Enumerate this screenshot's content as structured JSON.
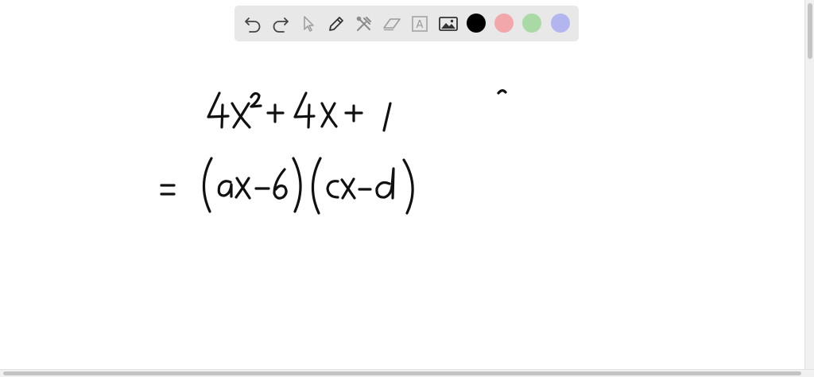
{
  "toolbar": {
    "tools": [
      {
        "name": "undo-icon"
      },
      {
        "name": "redo-icon"
      },
      {
        "name": "pointer-icon"
      },
      {
        "name": "pencil-icon"
      },
      {
        "name": "tools-icon"
      },
      {
        "name": "eraser-icon"
      },
      {
        "name": "text-icon",
        "glyph": "A"
      },
      {
        "name": "image-icon"
      }
    ],
    "colors": {
      "black": "#000000",
      "red": "#f2a7ab",
      "green": "#a9d9a5",
      "blue": "#b3b5ef"
    },
    "selected_color": "black"
  },
  "whiteboard": {
    "line1": "4x² + 4x + 1",
    "line2": "= (ax − b)(cx − d)"
  }
}
